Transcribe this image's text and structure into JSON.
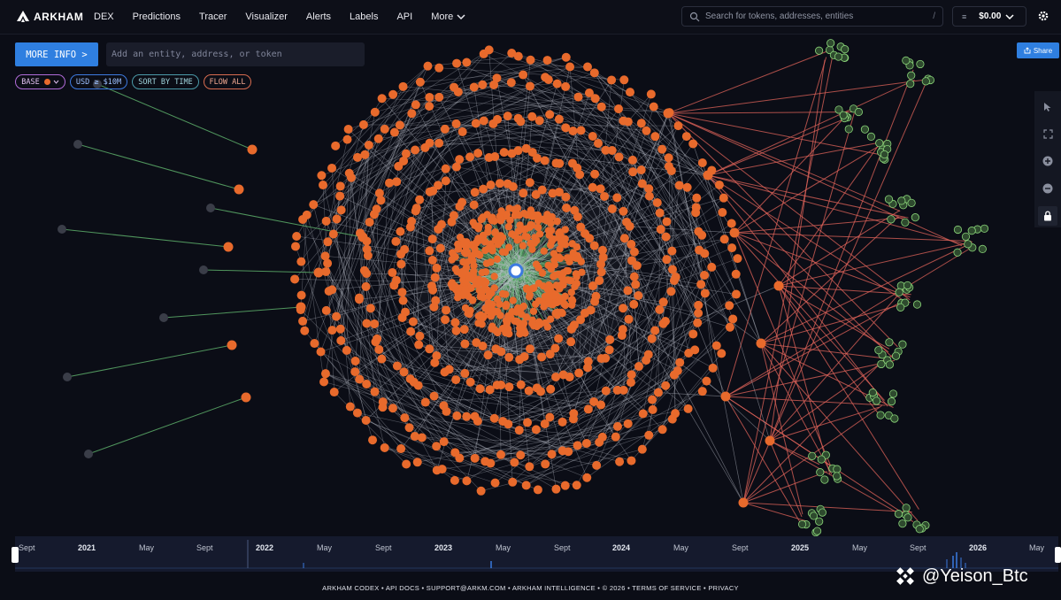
{
  "app": {
    "name": "ARKHAM"
  },
  "nav": {
    "items": [
      "DEX",
      "Predictions",
      "Tracer",
      "Visualizer",
      "Alerts",
      "Labels",
      "API"
    ],
    "more": "More"
  },
  "search": {
    "placeholder": "Search for tokens, addresses, entities",
    "shortcut": "/"
  },
  "wallet": {
    "balance": "$0.00",
    "icon": "≡"
  },
  "controls": {
    "more_info": "MORE INFO >",
    "entity_placeholder": "Add an entity, address, or token",
    "pills": {
      "base": "BASE",
      "usd": "USD ≥ $10M",
      "sort": "SORT BY TIME",
      "flow": "FLOW ALL"
    },
    "share": "Share"
  },
  "timeline": {
    "labels": [
      "Sept",
      "2021",
      "May",
      "Sept",
      "2022",
      "May",
      "Sept",
      "2023",
      "May",
      "Sept",
      "2024",
      "May",
      "Sept",
      "2025",
      "May",
      "Sept",
      "2026",
      "May"
    ],
    "years": [
      "2021",
      "2022",
      "2023",
      "2024",
      "2025",
      "2026"
    ]
  },
  "footer": "ARKHAM CODEX • API DOCS • SUPPORT@ARKM.COM • ARKHAM INTELLIGENCE • © 2026 • TERMS OF SERVICE • PRIVACY",
  "watermark": "@Yeison_Btc",
  "colors": {
    "accent": "#2f7fe0",
    "node": "#e86a2c",
    "inflow": "#5dae6a",
    "outflow": "#e2645a",
    "edge": "#b9bdc8",
    "background": "#0b0d16"
  }
}
